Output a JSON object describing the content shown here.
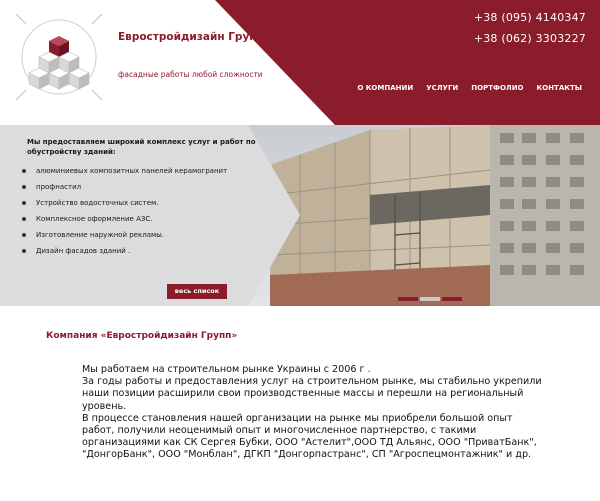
{
  "header": {
    "company_name": "Евростройдизайн Групп",
    "tagline": "фасадные работы любой сложности",
    "phones": [
      "+38 (095) 4140347",
      "+38 (062) 3303227"
    ],
    "nav": [
      "О КОМПАНИИ",
      "УСЛУГИ",
      "ПОРТФОЛИО",
      "КОНТАКТЫ"
    ]
  },
  "hero": {
    "intro": "Мы предоставляем широкий комплекс услуг и работ по обустройству зданий:",
    "services": [
      "алюминиевых композитных панелей керамогранит",
      "профнастил",
      "Устройство водосточных систем.",
      "Комплексное оформление АЗС.",
      "Изготовление наружной рекламы.",
      "Дизайн фасадов зданий ."
    ],
    "button_label": "весь список",
    "slider": {
      "count": 3,
      "active_index": 1
    }
  },
  "content": {
    "title": "Компания «Евростройдизайн Групп»",
    "paragraphs": [
      "Мы работаем на строительном рынке Украины с 2006 г .",
      " За годы работы и предоставления услуг на строительном рынке, мы стабильно укрепили наши позиции расширили свои производственные массы и перешли на региональный уровень.",
      "  В процессе становления нашей организации на рынке мы приобрели большой опыт работ, получили неоценимый опыт и многочисленное партнерство, с такими организациями как СК Сергея Бубки, ООО \"Астелит\",ООО ТД Альянс, ООО \"ПриватБанк\", \"ДонгорБанк\", ООО \"Монблан\", ДГКП \"Донгорпастранс\", СП \"Агроспецмонтажник\" и др."
    ]
  },
  "colors": {
    "brand": "#8b1c2c",
    "hero_panel": "#dcdcde",
    "text": "#1a1a1a"
  }
}
